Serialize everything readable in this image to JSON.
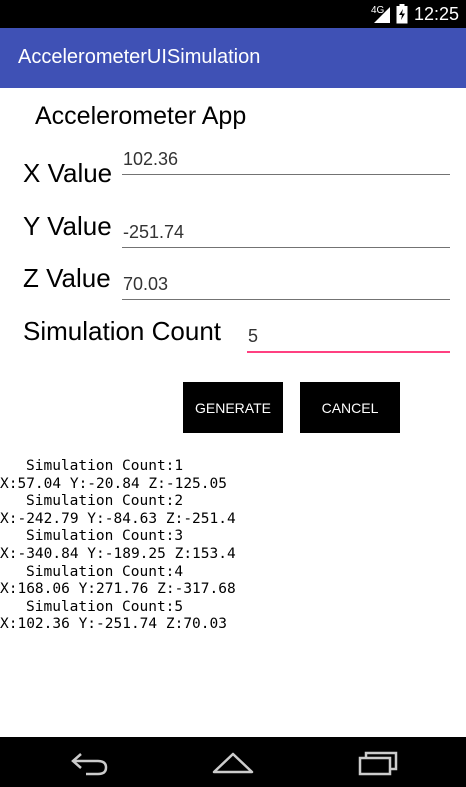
{
  "status_bar": {
    "network": "4G",
    "time": "12:25"
  },
  "app_bar": {
    "title": "AccelerometerUISimulation"
  },
  "main": {
    "heading": "Accelerometer App",
    "x_label": "X Value",
    "x_value": "102.36",
    "y_label": "Y Value",
    "y_value": "-251.74",
    "z_label": "Z Value",
    "z_value": "70.03",
    "count_label": "Simulation Count",
    "count_value": "5",
    "generate_label": "GENERATE",
    "cancel_label": "CANCEL"
  },
  "log": [
    {
      "count": "Simulation Count:1",
      "xyz": "X:57.04 Y:-20.84 Z:-125.05"
    },
    {
      "count": "Simulation Count:2",
      "xyz": "X:-242.79 Y:-84.63 Z:-251.4"
    },
    {
      "count": "Simulation Count:3",
      "xyz": "X:-340.84 Y:-189.25 Z:153.4"
    },
    {
      "count": "Simulation Count:4",
      "xyz": "X:168.06 Y:271.76 Z:-317.68"
    },
    {
      "count": "Simulation Count:5",
      "xyz": "X:102.36 Y:-251.74 Z:70.03"
    }
  ],
  "nav_bar": {
    "icons": [
      "back-icon",
      "home-icon",
      "recents-icon"
    ]
  },
  "colors": {
    "app_bar": "#3f51b5",
    "accent": "#ff4081",
    "button": "#000000"
  }
}
